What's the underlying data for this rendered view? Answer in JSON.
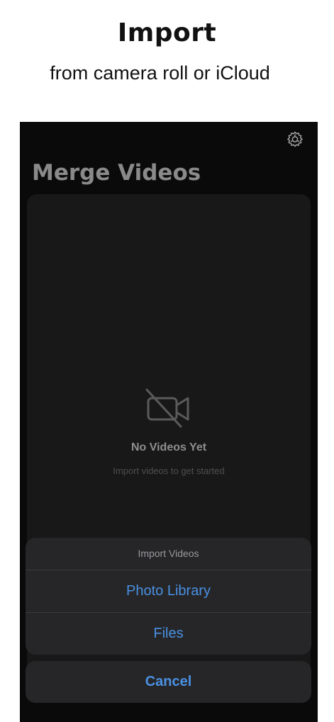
{
  "promo": {
    "title": "Import",
    "subtitle": "from camera roll or iCloud"
  },
  "app": {
    "title": "Merge Videos",
    "settings_icon": "gear-icon"
  },
  "empty_state": {
    "icon": "video-slash-icon",
    "title": "No Videos Yet",
    "subtitle": "Import videos to get started"
  },
  "action_sheet": {
    "title": "Import Videos",
    "actions": [
      {
        "label": "Photo Library"
      },
      {
        "label": "Files"
      }
    ],
    "cancel_label": "Cancel"
  },
  "colors": {
    "accent": "#4a90e2",
    "background": "#0a0a0a",
    "sheet": "#262628"
  }
}
